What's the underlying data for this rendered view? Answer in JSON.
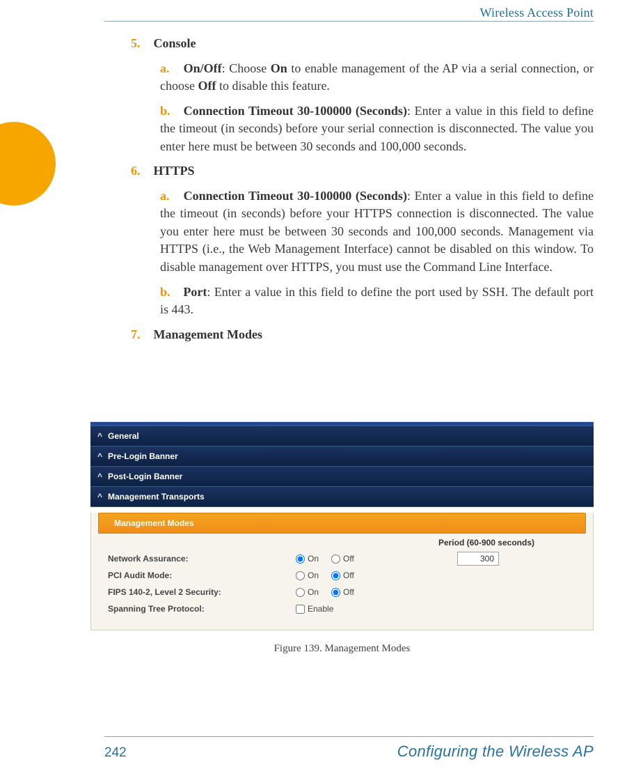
{
  "header": {
    "title": "Wireless Access Point"
  },
  "items": {
    "i5": {
      "marker": "5.",
      "heading": "Console",
      "a": {
        "marker": "a.",
        "lead": "On/Off",
        "body1": ": Choose ",
        "on": "On",
        "body2": " to enable management of the AP via a serial connection, or choose ",
        "off": "Off",
        "body3": " to disable this feature."
      },
      "b": {
        "marker": "b.",
        "lead": "Connection Timeout 30-100000 (Seconds)",
        "body": ": Enter a value in this field to define the timeout (in seconds) before your serial connection is disconnected. The value you enter here must be between 30 seconds and 100,000 seconds."
      }
    },
    "i6": {
      "marker": "6.",
      "heading": "HTTPS",
      "a": {
        "marker": "a.",
        "lead": "Connection Timeout 30-100000 (Seconds)",
        "body": ": Enter a value in this field to define the timeout (in seconds) before your HTTPS connection is disconnected. The value you enter here must be between 30 seconds and 100,000 seconds. Management via HTTPS (i.e., the Web Management Interface) cannot be disabled on this window. To disable management over HTTPS, you must use the Command Line Interface."
      },
      "b": {
        "marker": "b.",
        "lead": "Port",
        "body": ": Enter a value in this field to define the port used by SSH. The default port is 443."
      }
    },
    "i7": {
      "marker": "7.",
      "heading": "Management Modes"
    }
  },
  "figure": {
    "caption": "Figure 139. Management Modes",
    "accordion": {
      "general": "General",
      "prelogin": "Pre-Login Banner",
      "postlogin": "Post-Login Banner",
      "transports": "Management Transports"
    },
    "section": "Management Modes",
    "periodHeader": "Period (60-900 seconds)",
    "rows": {
      "network": {
        "label": "Network Assurance:",
        "on": "On",
        "off": "Off",
        "period": "300"
      },
      "pci": {
        "label": "PCI Audit Mode:",
        "on": "On",
        "off": "Off"
      },
      "fips": {
        "label": "FIPS 140-2, Level 2 Security:",
        "on": "On",
        "off": "Off"
      },
      "stp": {
        "label": "Spanning Tree Protocol:",
        "enable": "Enable"
      }
    }
  },
  "footer": {
    "page": "242",
    "title": "Configuring the Wireless AP"
  }
}
